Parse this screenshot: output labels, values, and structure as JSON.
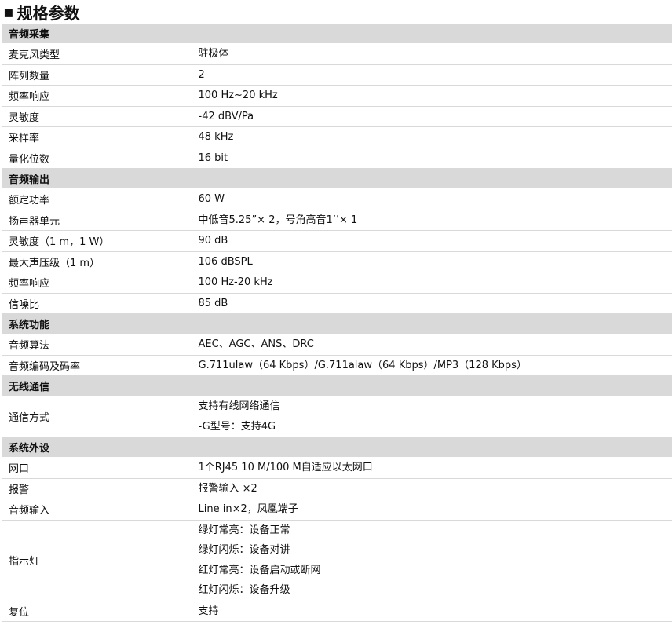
{
  "title": "规格参数",
  "sections": [
    {
      "name": "音频采集",
      "rows": [
        {
          "key": "麦克风类型",
          "lines": [
            "驻极体"
          ]
        },
        {
          "key": "阵列数量",
          "lines": [
            "2"
          ]
        },
        {
          "key": "频率响应",
          "lines": [
            "100 Hz~20 kHz"
          ]
        },
        {
          "key": "灵敏度",
          "lines": [
            "-42 dBV/Pa"
          ]
        },
        {
          "key": "采样率",
          "lines": [
            "48 kHz"
          ]
        },
        {
          "key": "量化位数",
          "lines": [
            "16 bit"
          ]
        }
      ]
    },
    {
      "name": "音频输出",
      "rows": [
        {
          "key": "额定功率",
          "lines": [
            "60 W"
          ]
        },
        {
          "key": "扬声器单元",
          "lines": [
            "中低音5.25”× 2，号角高音1’’× 1"
          ]
        },
        {
          "key": "灵敏度（1 m，1 W）",
          "lines": [
            "90 dB"
          ]
        },
        {
          "key": "最大声压级（1 m）",
          "lines": [
            "106 dBSPL"
          ]
        },
        {
          "key": "频率响应",
          "lines": [
            "100 Hz-20 kHz"
          ]
        },
        {
          "key": "信噪比",
          "lines": [
            "85 dB"
          ]
        }
      ]
    },
    {
      "name": "系统功能",
      "rows": [
        {
          "key": "音频算法",
          "lines": [
            "AEC、AGC、ANS、DRC"
          ]
        },
        {
          "key": "音频编码及码率",
          "lines": [
            "G.711ulaw（64 Kbps）/G.711alaw（64 Kbps）/MP3（128 Kbps）"
          ]
        }
      ]
    },
    {
      "name": "无线通信",
      "rows": [
        {
          "key": "通信方式",
          "lines": [
            "支持有线网络通信",
            "-G型号：支持4G"
          ]
        }
      ]
    },
    {
      "name": "系统外设",
      "rows": [
        {
          "key": "网口",
          "lines": [
            "1个RJ45 10 M/100 M自适应以太网口"
          ]
        },
        {
          "key": "报警",
          "lines": [
            "报警输入 ×2"
          ]
        },
        {
          "key": "音频输入",
          "lines": [
            "Line in×2，凤凰端子"
          ]
        },
        {
          "key": "指示灯",
          "lines": [
            "绿灯常亮：设备正常",
            "绿灯闪烁：设备对讲",
            "红灯常亮：设备启动或断网",
            "红灯闪烁：设备升级"
          ]
        },
        {
          "key": "复位",
          "lines": [
            "支持"
          ]
        }
      ]
    }
  ]
}
